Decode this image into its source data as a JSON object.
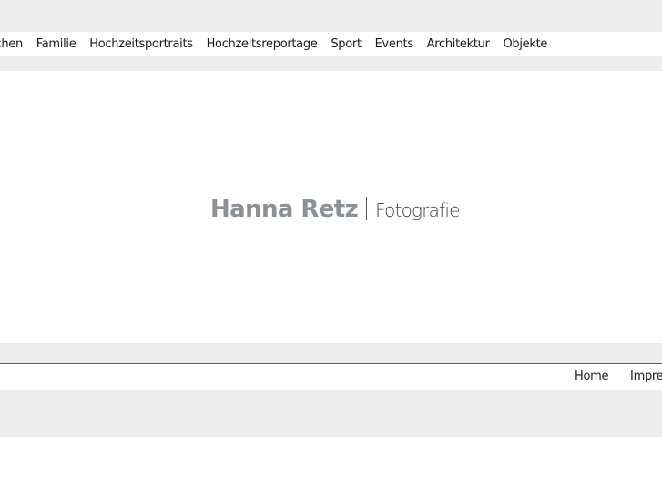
{
  "nav": {
    "items": [
      {
        "label": "schen"
      },
      {
        "label": "Familie"
      },
      {
        "label": "Hochzeitsportraits"
      },
      {
        "label": "Hochzeitsreportage"
      },
      {
        "label": "Sport"
      },
      {
        "label": "Events"
      },
      {
        "label": "Architektur"
      },
      {
        "label": "Objekte"
      }
    ]
  },
  "logo": {
    "name": "Hanna Retz",
    "subtitle": "Fotografie"
  },
  "footer": {
    "items": [
      {
        "label": "Home"
      },
      {
        "label": "Impres"
      }
    ]
  },
  "colors": {
    "page_gray": "#ededed",
    "logo_name": "#8a9199",
    "text": "#1a1a1a"
  }
}
